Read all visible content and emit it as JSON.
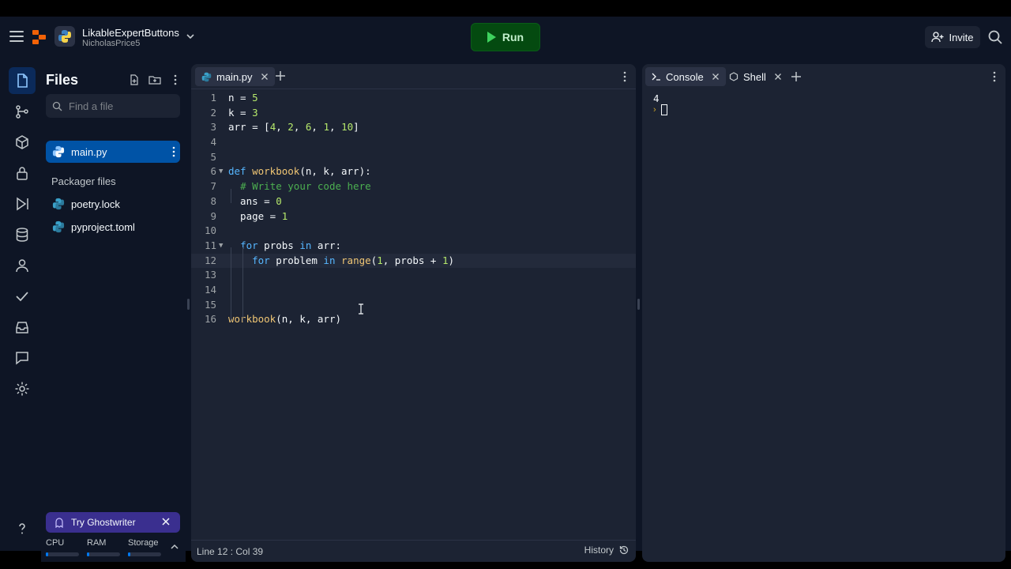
{
  "header": {
    "repl_name": "LikableExpertButtons",
    "owner": "NicholasPrice5",
    "run_label": "Run",
    "invite_label": "Invite"
  },
  "files": {
    "title": "Files",
    "search_placeholder": "Find a file",
    "items": [
      {
        "name": "main.py",
        "selected": true
      }
    ],
    "packager_label": "Packager files",
    "packager_items": [
      {
        "name": "poetry.lock"
      },
      {
        "name": "pyproject.toml"
      }
    ],
    "ghostwriter_label": "Try Ghostwriter",
    "resources": {
      "cpu_label": "CPU",
      "ram_label": "RAM",
      "storage_label": "Storage"
    }
  },
  "editor": {
    "tab_label": "main.py",
    "status": "Line 12 : Col 39",
    "history_label": "History",
    "line_numbers": [
      "1",
      "2",
      "3",
      "4",
      "5",
      "6",
      "7",
      "8",
      "9",
      "10",
      "11",
      "12",
      "13",
      "14",
      "15",
      "16"
    ]
  },
  "console": {
    "tabs": [
      {
        "label": "Console"
      },
      {
        "label": "Shell"
      }
    ],
    "output": "4"
  },
  "colors": {
    "bg": "#0e1525",
    "panel": "#1c2333",
    "run_bg": "#044a10",
    "selected_file": "#0053a6",
    "ghostwriter": "#3a2f8f"
  }
}
